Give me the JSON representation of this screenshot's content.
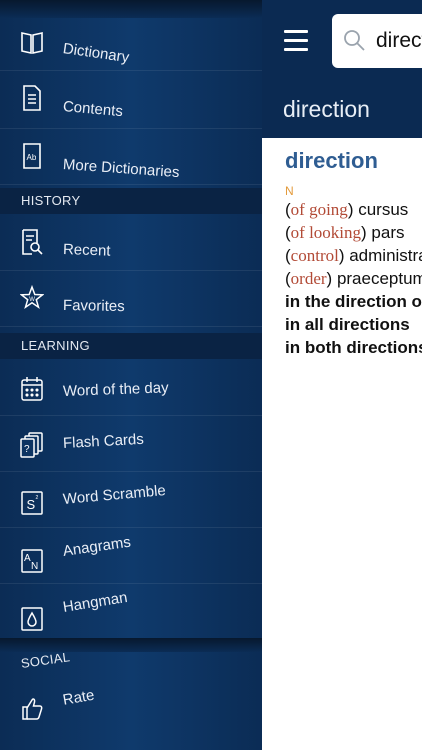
{
  "menu": {
    "dictionary": "Dictionary",
    "contents": "Contents",
    "more_dictionaries": "More Dictionaries",
    "history_header": "HISTORY",
    "recent": "Recent",
    "favorites": "Favorites",
    "learning_header": "LEARNING",
    "word_of_the_day": "Word of the day",
    "flash_cards": "Flash Cards",
    "word_scramble": "Word Scramble",
    "anagrams": "Anagrams",
    "hangman": "Hangman",
    "social_header": "SOCIAL",
    "rate": "Rate"
  },
  "search": {
    "value": "direction"
  },
  "header": {
    "word": "direction"
  },
  "entry": {
    "headword": "direction",
    "pos": "N",
    "senses": [
      {
        "context": "of going",
        "translation": "cursus"
      },
      {
        "context": "of looking",
        "translation": "pars"
      },
      {
        "context": "control",
        "translation": "administratio"
      },
      {
        "context": "order",
        "translation": "praeceptum"
      }
    ],
    "phrases": [
      "in the direction of",
      "in all directions",
      "in both directions"
    ]
  },
  "icons": {
    "dictionary": "book-icon",
    "contents": "document-icon",
    "more_dictionaries": "ab-book-icon",
    "recent": "recent-search-icon",
    "favorites": "star-icon",
    "word_of_the_day": "calendar-icon",
    "flash_cards": "cards-icon",
    "word_scramble": "scramble-tile-icon",
    "anagrams": "anagram-tile-icon",
    "hangman": "hangman-drop-icon",
    "rate": "thumbs-up-icon"
  }
}
